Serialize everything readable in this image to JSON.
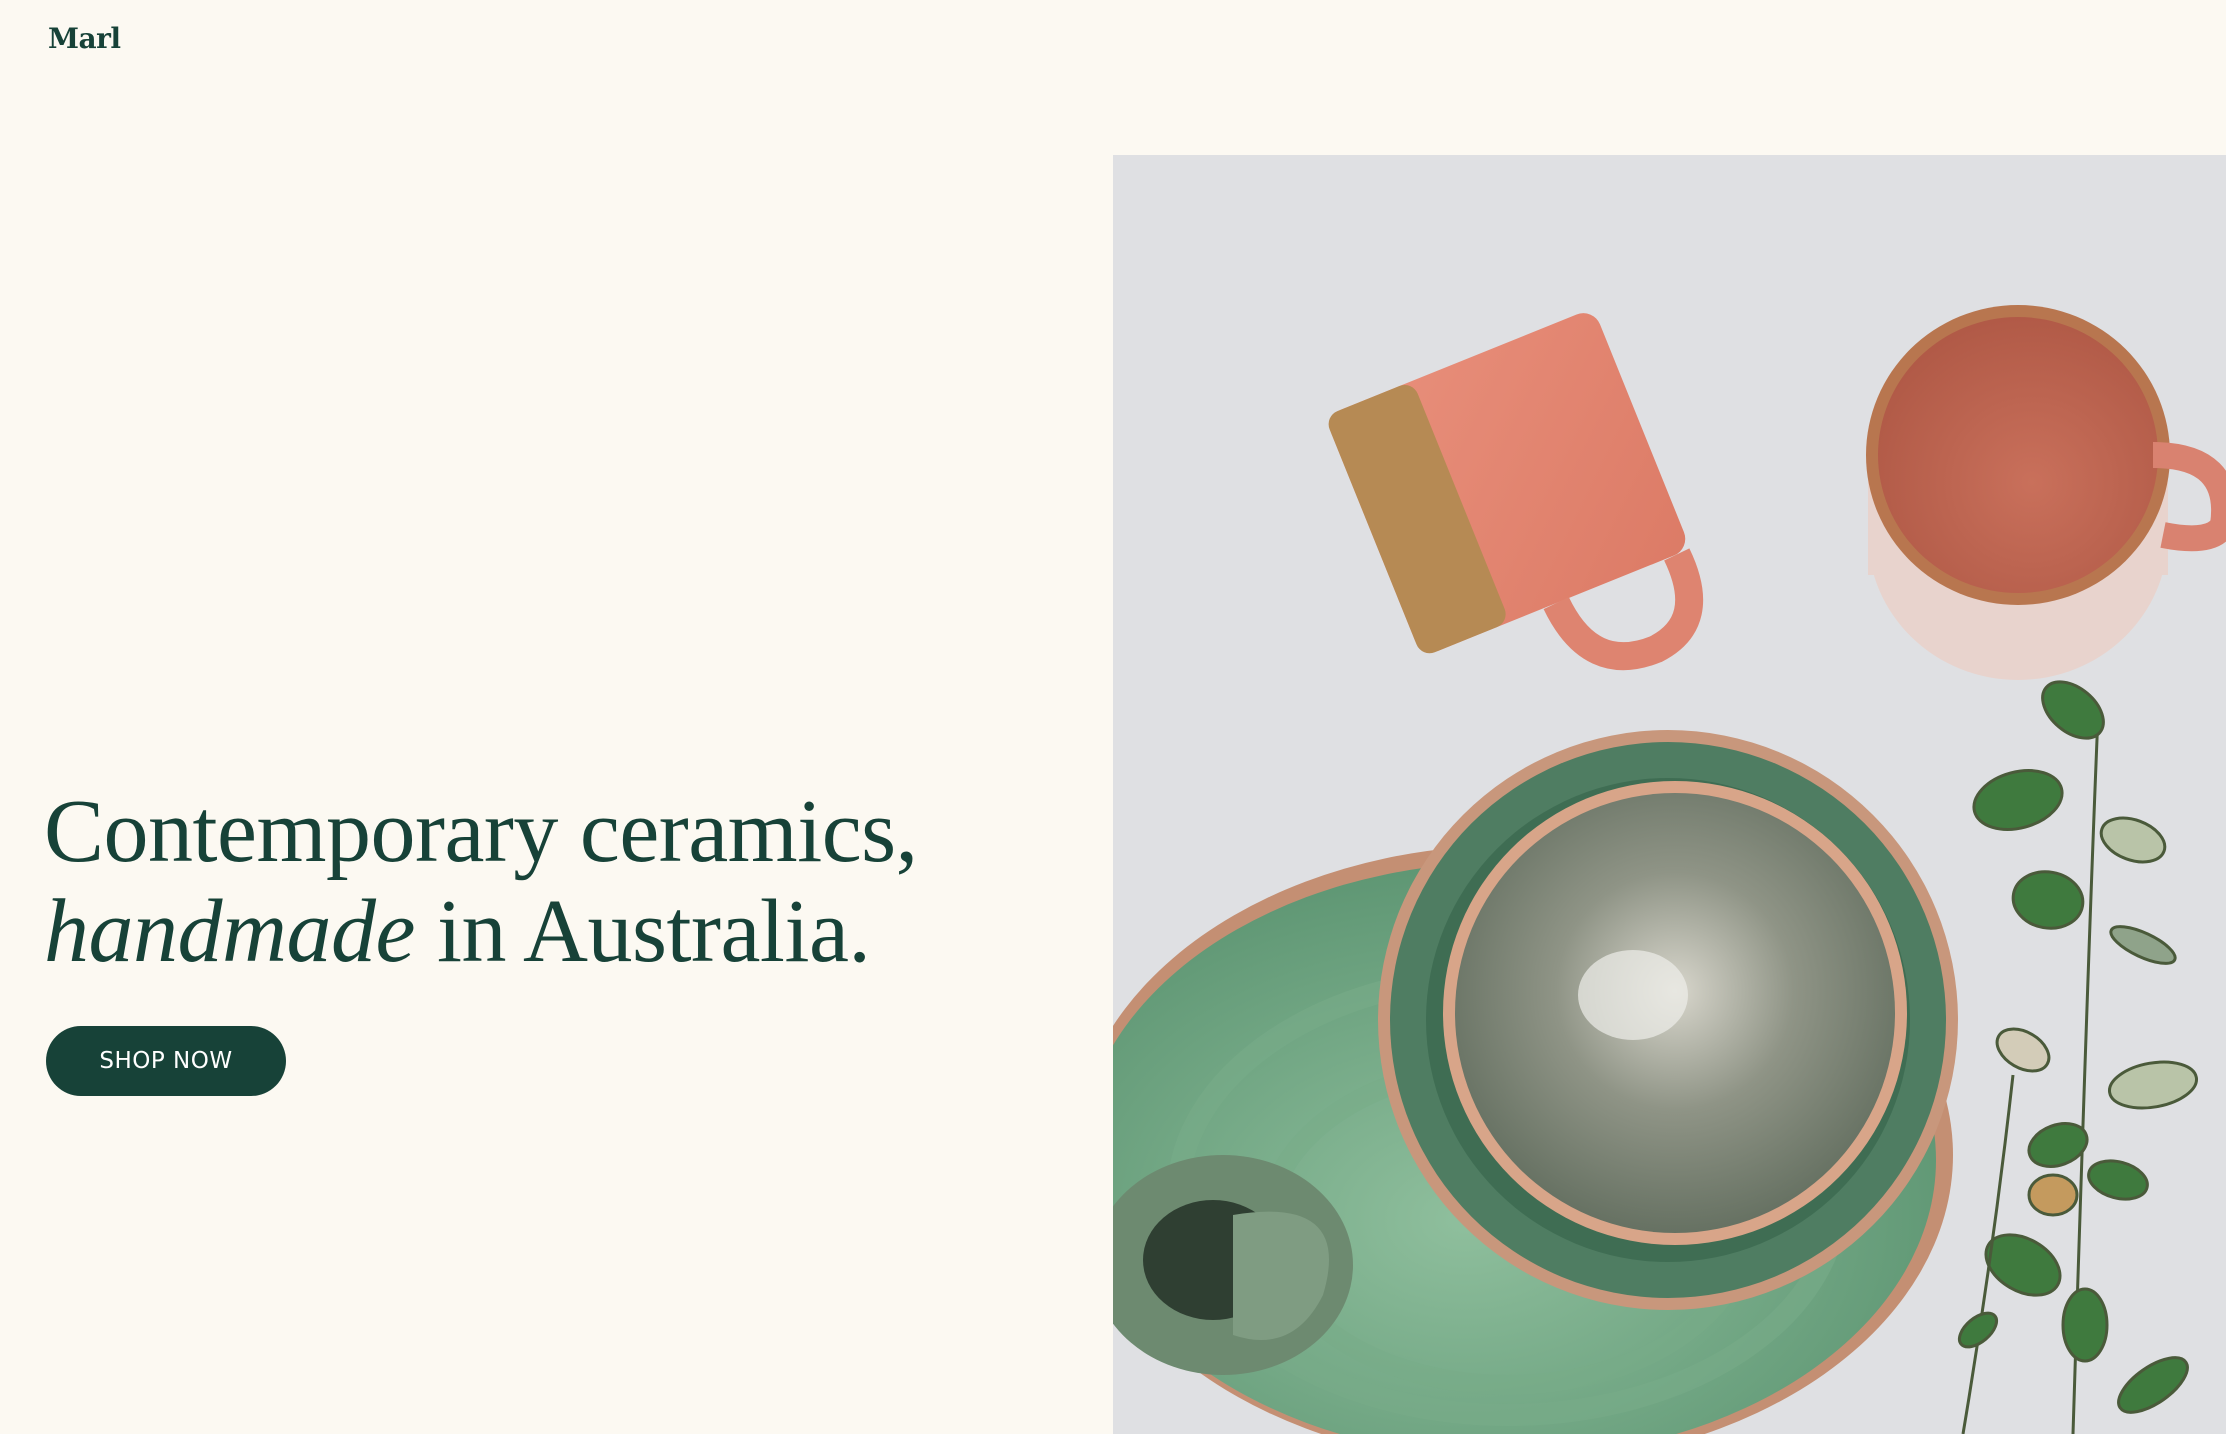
{
  "brand": {
    "name": "Marl"
  },
  "hero": {
    "headline_line1": "Contemporary ceramics,",
    "headline_italic": "handmade",
    "headline_line2_rest": " in Australia.",
    "cta_label": "SHOP NOW"
  },
  "colors": {
    "background": "#fcf9f2",
    "brand_green": "#174238",
    "button_text": "#ffffff"
  }
}
